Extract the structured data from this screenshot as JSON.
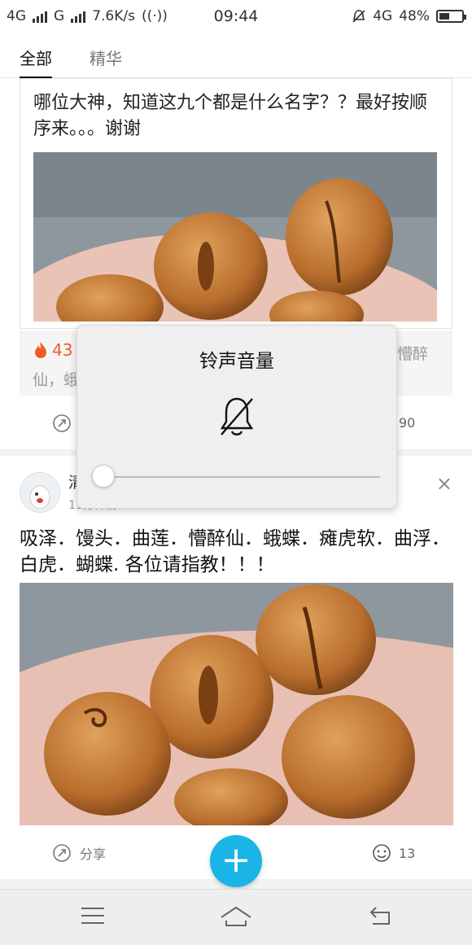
{
  "status_bar": {
    "net1": "4G",
    "net2": "G",
    "speed": "7.6K/s",
    "time": "09:44",
    "net3": "4G",
    "battery": "48%",
    "battery_level": 0.48
  },
  "tabs": [
    {
      "label": "全部",
      "active": true
    },
    {
      "label": "精华",
      "active": false
    }
  ],
  "post1": {
    "question": "哪位大神，知道这九个都是什么名字？？最好按顺序来。。。谢谢",
    "hot_count": "43",
    "meta_right": "懵醉",
    "meta_second": "仙，蛾",
    "count": "90"
  },
  "post2": {
    "user": "清",
    "time": "11分钟前",
    "text": "吸泽．馒头．曲莲．懵醉仙．蛾蝶．瘫虎软．曲浮．白虎．蝴蝶. 各位请指教！！！",
    "share_label": "分享",
    "count": "13"
  },
  "fab_label": "+",
  "volume_popup": {
    "title": "铃声音量",
    "level": 0.0
  },
  "colors": {
    "accent": "#1ab5e6",
    "hot": "#f25a27"
  }
}
